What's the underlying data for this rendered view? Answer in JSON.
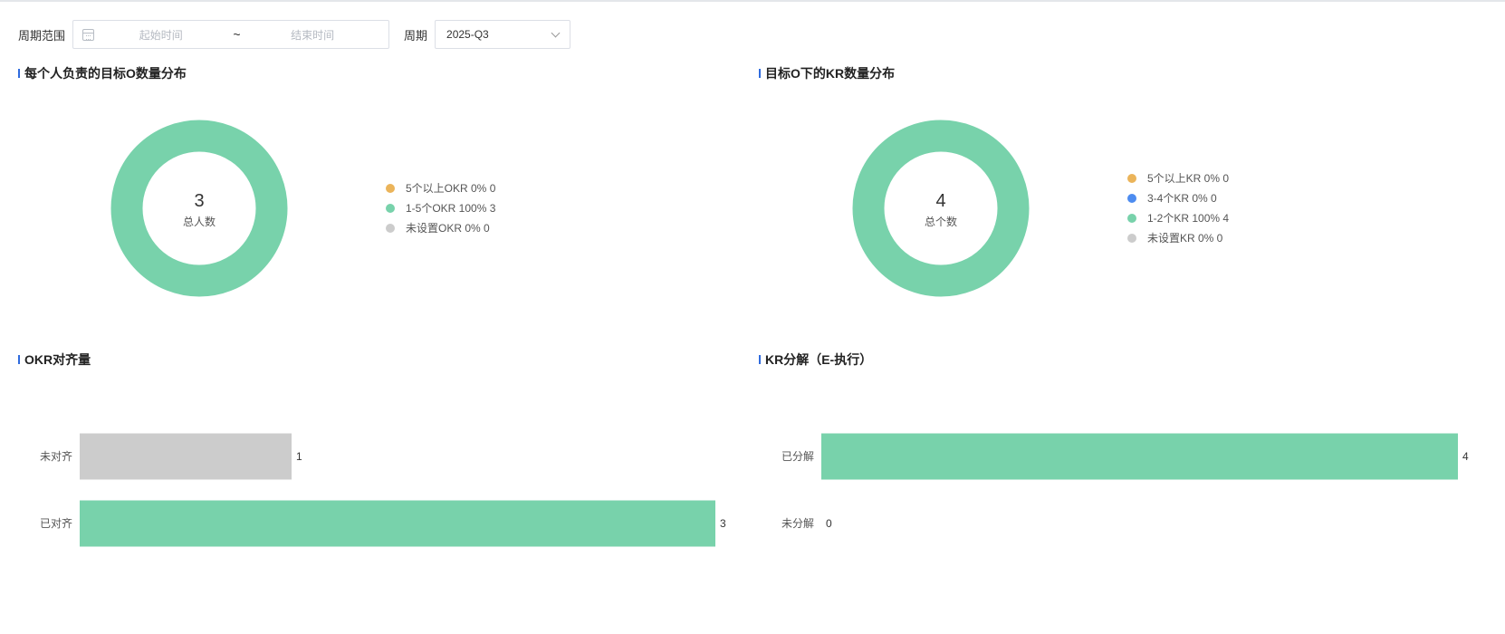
{
  "filters": {
    "range_label": "周期范围",
    "start_placeholder": "起始时间",
    "range_separator": "~",
    "end_placeholder": "结束时间",
    "period_label": "周期",
    "period_value": "2025-Q3"
  },
  "colors": {
    "green": "#78d2ab",
    "orange": "#ebb45a",
    "blue": "#4d8cf0",
    "gray": "#cccccc",
    "title_accent": "#2f6bde"
  },
  "chart_data": [
    {
      "type": "pie",
      "title": "每个人负责的目标O数量分布",
      "center_value": "3",
      "center_label": "总人数",
      "slices": [
        {
          "label": "5个以上OKR",
          "percent": "0%",
          "value": 0,
          "color": "#ebb45a"
        },
        {
          "label": "1-5个OKR",
          "percent": "100%",
          "value": 3,
          "color": "#78d2ab"
        },
        {
          "label": "未设置OKR",
          "percent": "0%",
          "value": 0,
          "color": "#cccccc"
        }
      ]
    },
    {
      "type": "pie",
      "title": "目标O下的KR数量分布",
      "center_value": "4",
      "center_label": "总个数",
      "slices": [
        {
          "label": "5个以上KR",
          "percent": "0%",
          "value": 0,
          "color": "#ebb45a"
        },
        {
          "label": "3-4个KR",
          "percent": "0%",
          "value": 0,
          "color": "#4d8cf0"
        },
        {
          "label": "1-2个KR",
          "percent": "100%",
          "value": 4,
          "color": "#78d2ab"
        },
        {
          "label": "未设置KR",
          "percent": "0%",
          "value": 0,
          "color": "#cccccc"
        }
      ]
    },
    {
      "type": "bar",
      "orientation": "horizontal",
      "title": "OKR对齐量",
      "categories": [
        "未对齐",
        "已对齐"
      ],
      "values": [
        1,
        3
      ],
      "colors": [
        "#cccccc",
        "#78d2ab"
      ],
      "xlim": [
        0,
        3
      ]
    },
    {
      "type": "bar",
      "orientation": "horizontal",
      "title": "KR分解（E-执行）",
      "categories": [
        "已分解",
        "未分解"
      ],
      "values": [
        4,
        0
      ],
      "colors": [
        "#78d2ab",
        "#78d2ab"
      ],
      "xlim": [
        0,
        4
      ]
    }
  ]
}
